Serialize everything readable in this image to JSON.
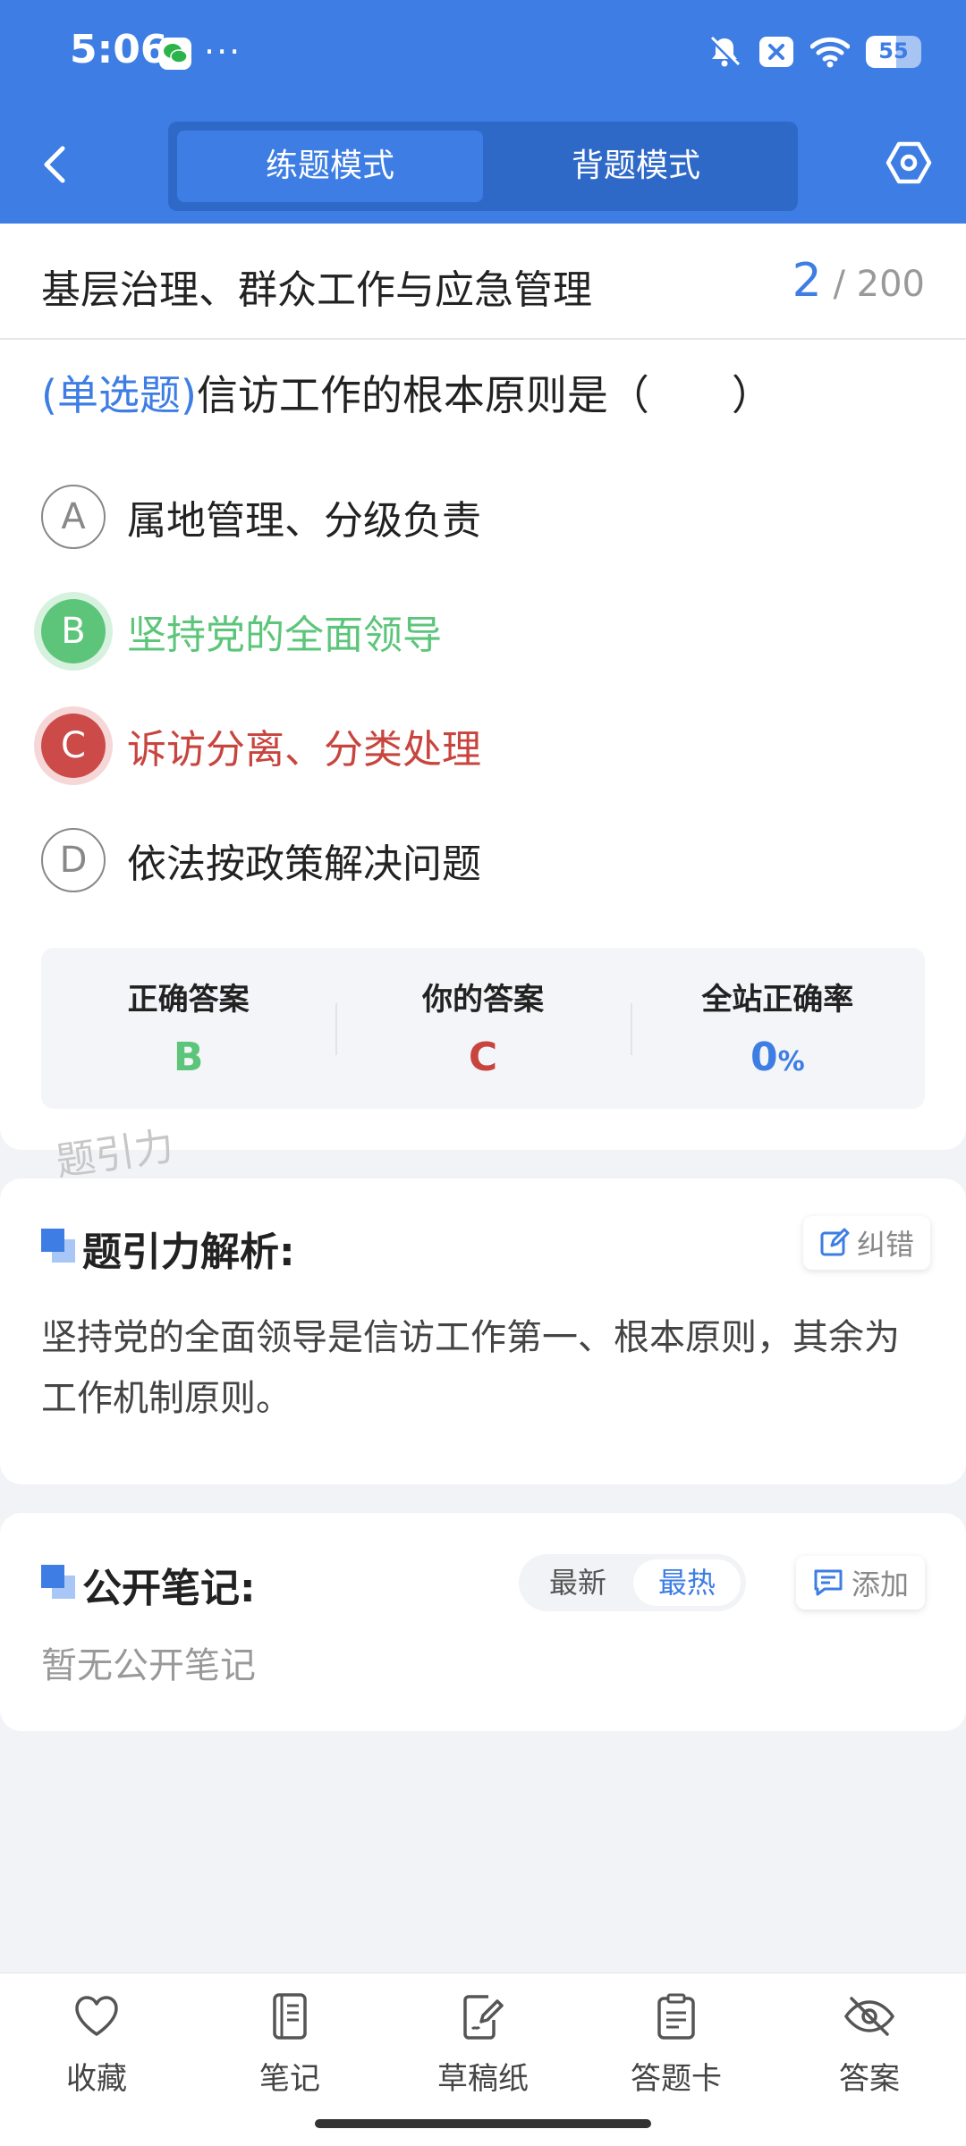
{
  "status_bar": {
    "time": "5:06",
    "more": "···",
    "battery": "55",
    "battery_level": 0.55
  },
  "header": {
    "tabs": [
      {
        "label": "练题模式",
        "active": true
      },
      {
        "label": "背题模式",
        "active": false
      }
    ]
  },
  "question_card": {
    "chapter": "基层治理、群众工作与应急管理",
    "progress_current": "2",
    "progress_total": "/ 200",
    "question_type": "(单选题)",
    "question_text": "信访工作的根本原则是（　　）",
    "options": [
      {
        "letter": "A",
        "text": "属地管理、分级负责",
        "state": "normal"
      },
      {
        "letter": "B",
        "text": "坚持党的全面领导",
        "state": "correct"
      },
      {
        "letter": "C",
        "text": "诉访分离、分类处理",
        "state": "wrong"
      },
      {
        "letter": "D",
        "text": "依法按政策解决问题",
        "state": "normal"
      }
    ],
    "stats": {
      "correct_label": "正确答案",
      "correct_value": "B",
      "yours_label": "你的答案",
      "yours_value": "C",
      "rate_label": "全站正确率",
      "rate_value": "0",
      "rate_unit": "%"
    }
  },
  "watermark": "题引力",
  "analysis": {
    "title": "题引力解析:",
    "report_button": "纠错",
    "text": "坚持党的全面领导是信访工作第一、根本原则，其余为工作机制原则。"
  },
  "notes": {
    "title": "公开笔记:",
    "sort_options": [
      "最新",
      "最热"
    ],
    "sort_selected": "最热",
    "add_button": "添加",
    "empty_text": "暂无公开笔记"
  },
  "bottom_bar": {
    "items": [
      {
        "label": "收藏",
        "icon": "heart-icon"
      },
      {
        "label": "笔记",
        "icon": "notebook-icon"
      },
      {
        "label": "草稿纸",
        "icon": "draft-paper-icon"
      },
      {
        "label": "答题卡",
        "icon": "answer-sheet-icon"
      },
      {
        "label": "答案",
        "icon": "eye-off-icon"
      }
    ]
  },
  "colors": {
    "brand": "#3d7de4",
    "correct": "#5cc57a",
    "wrong": "#c8453f"
  }
}
